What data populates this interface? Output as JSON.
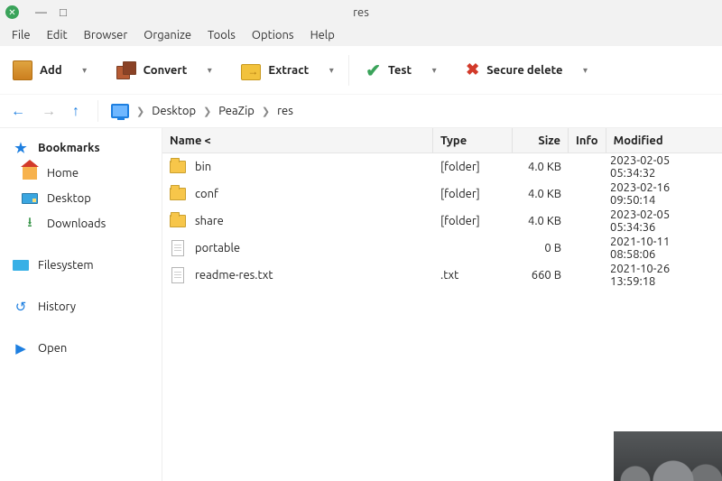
{
  "window": {
    "title": "res"
  },
  "menu": [
    "File",
    "Edit",
    "Browser",
    "Organize",
    "Tools",
    "Options",
    "Help"
  ],
  "toolbar": {
    "add": "Add",
    "convert": "Convert",
    "extract": "Extract",
    "test": "Test",
    "secure_delete": "Secure delete"
  },
  "breadcrumb": [
    "Desktop",
    "PeaZip",
    "res"
  ],
  "sidebar": {
    "bookmarks_label": "Bookmarks",
    "home": "Home",
    "desktop": "Desktop",
    "downloads": "Downloads",
    "filesystem": "Filesystem",
    "history": "History",
    "open": "Open"
  },
  "columns": {
    "name": "Name <",
    "type": "Type",
    "size": "Size",
    "info": "Info",
    "modified": "Modified"
  },
  "files": [
    {
      "name": "bin",
      "type": "[folder]",
      "size": "4.0 KB",
      "info": "",
      "modified": "2023-02-05 05:34:32",
      "kind": "folder"
    },
    {
      "name": "conf",
      "type": "[folder]",
      "size": "4.0 KB",
      "info": "",
      "modified": "2023-02-16 09:50:14",
      "kind": "folder"
    },
    {
      "name": "share",
      "type": "[folder]",
      "size": "4.0 KB",
      "info": "",
      "modified": "2023-02-05 05:34:36",
      "kind": "folder"
    },
    {
      "name": "portable",
      "type": "",
      "size": "0 B",
      "info": "",
      "modified": "2021-10-11 08:58:06",
      "kind": "file"
    },
    {
      "name": "readme-res.txt",
      "type": ".txt",
      "size": "660 B",
      "info": "",
      "modified": "2021-10-26 13:59:18",
      "kind": "file"
    }
  ]
}
